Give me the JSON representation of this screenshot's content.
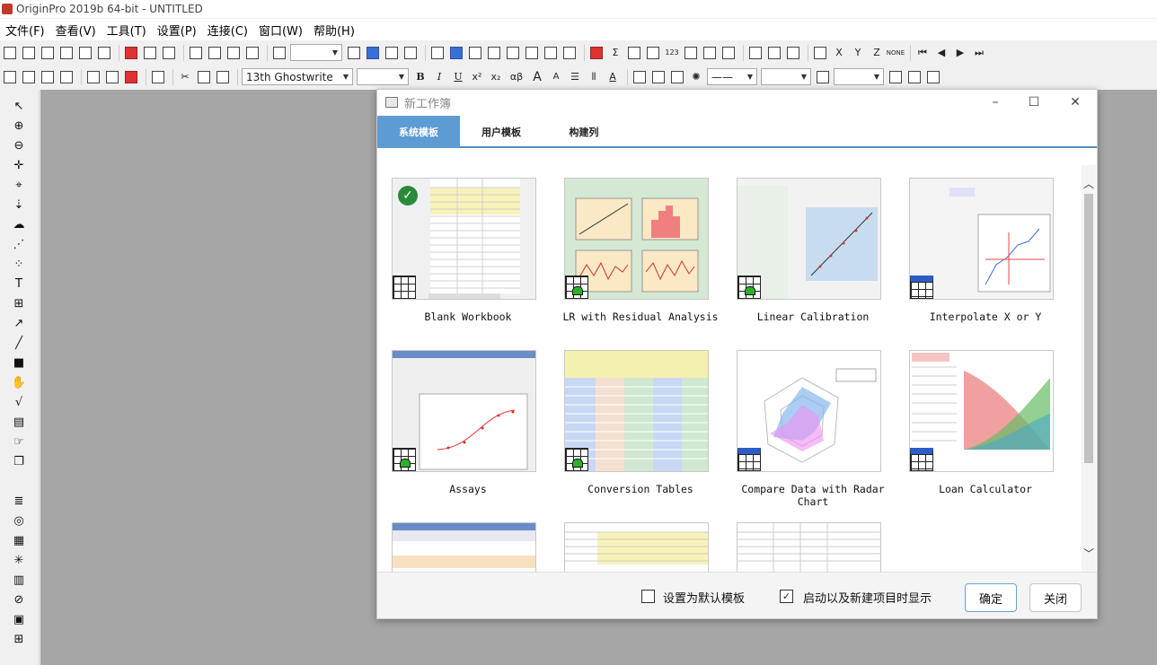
{
  "app": {
    "title": "OriginPro 2019b 64-bit - UNTITLED"
  },
  "menu": [
    "文件(F)",
    "查看(V)",
    "工具(T)",
    "设置(P)",
    "连接(C)",
    "窗口(W)",
    "帮助(H)"
  ],
  "toolbar": {
    "font_name": "13th Ghostwrite",
    "symbols": {
      "bold": "B",
      "italic": "I",
      "underline": "U",
      "superscript": "x²",
      "subscript": "x₂",
      "greek": "αβ",
      "grow_font": "A",
      "shrink_font": "A",
      "sigma": "Σ",
      "x_axis": "X",
      "y_axis": "Y",
      "z_axis": "Z",
      "none": "NONE",
      "sort_123": "123"
    }
  },
  "dialog": {
    "title": "新工作簿",
    "tabs": [
      {
        "label": "系统模板",
        "active": true
      },
      {
        "label": "用户模板",
        "active": false
      },
      {
        "label": "构建列",
        "active": false
      }
    ],
    "templates": [
      {
        "label": "Blank Workbook",
        "icon": "workbook-check-icon"
      },
      {
        "label": "LR with Residual Analysis",
        "icon": "graph-template-icon"
      },
      {
        "label": "Linear Calibration",
        "icon": "graph-template-icon"
      },
      {
        "label": "Interpolate X or Y",
        "icon": "workbook-template-icon"
      },
      {
        "label": "Assays",
        "icon": "graph-template-icon"
      },
      {
        "label": "Conversion Tables",
        "icon": "graph-template-icon"
      },
      {
        "label": "Compare Data with Radar Chart",
        "icon": "workbook-template-icon"
      },
      {
        "label": "Loan Calculator",
        "icon": "workbook-template-icon"
      }
    ],
    "footer": {
      "default_checkbox_label": "设置为默认模板",
      "default_checked": false,
      "startup_checkbox_label": "启动以及新建项目时显示",
      "startup_checked": true,
      "ok_label": "确定",
      "close_label": "关闭"
    }
  }
}
